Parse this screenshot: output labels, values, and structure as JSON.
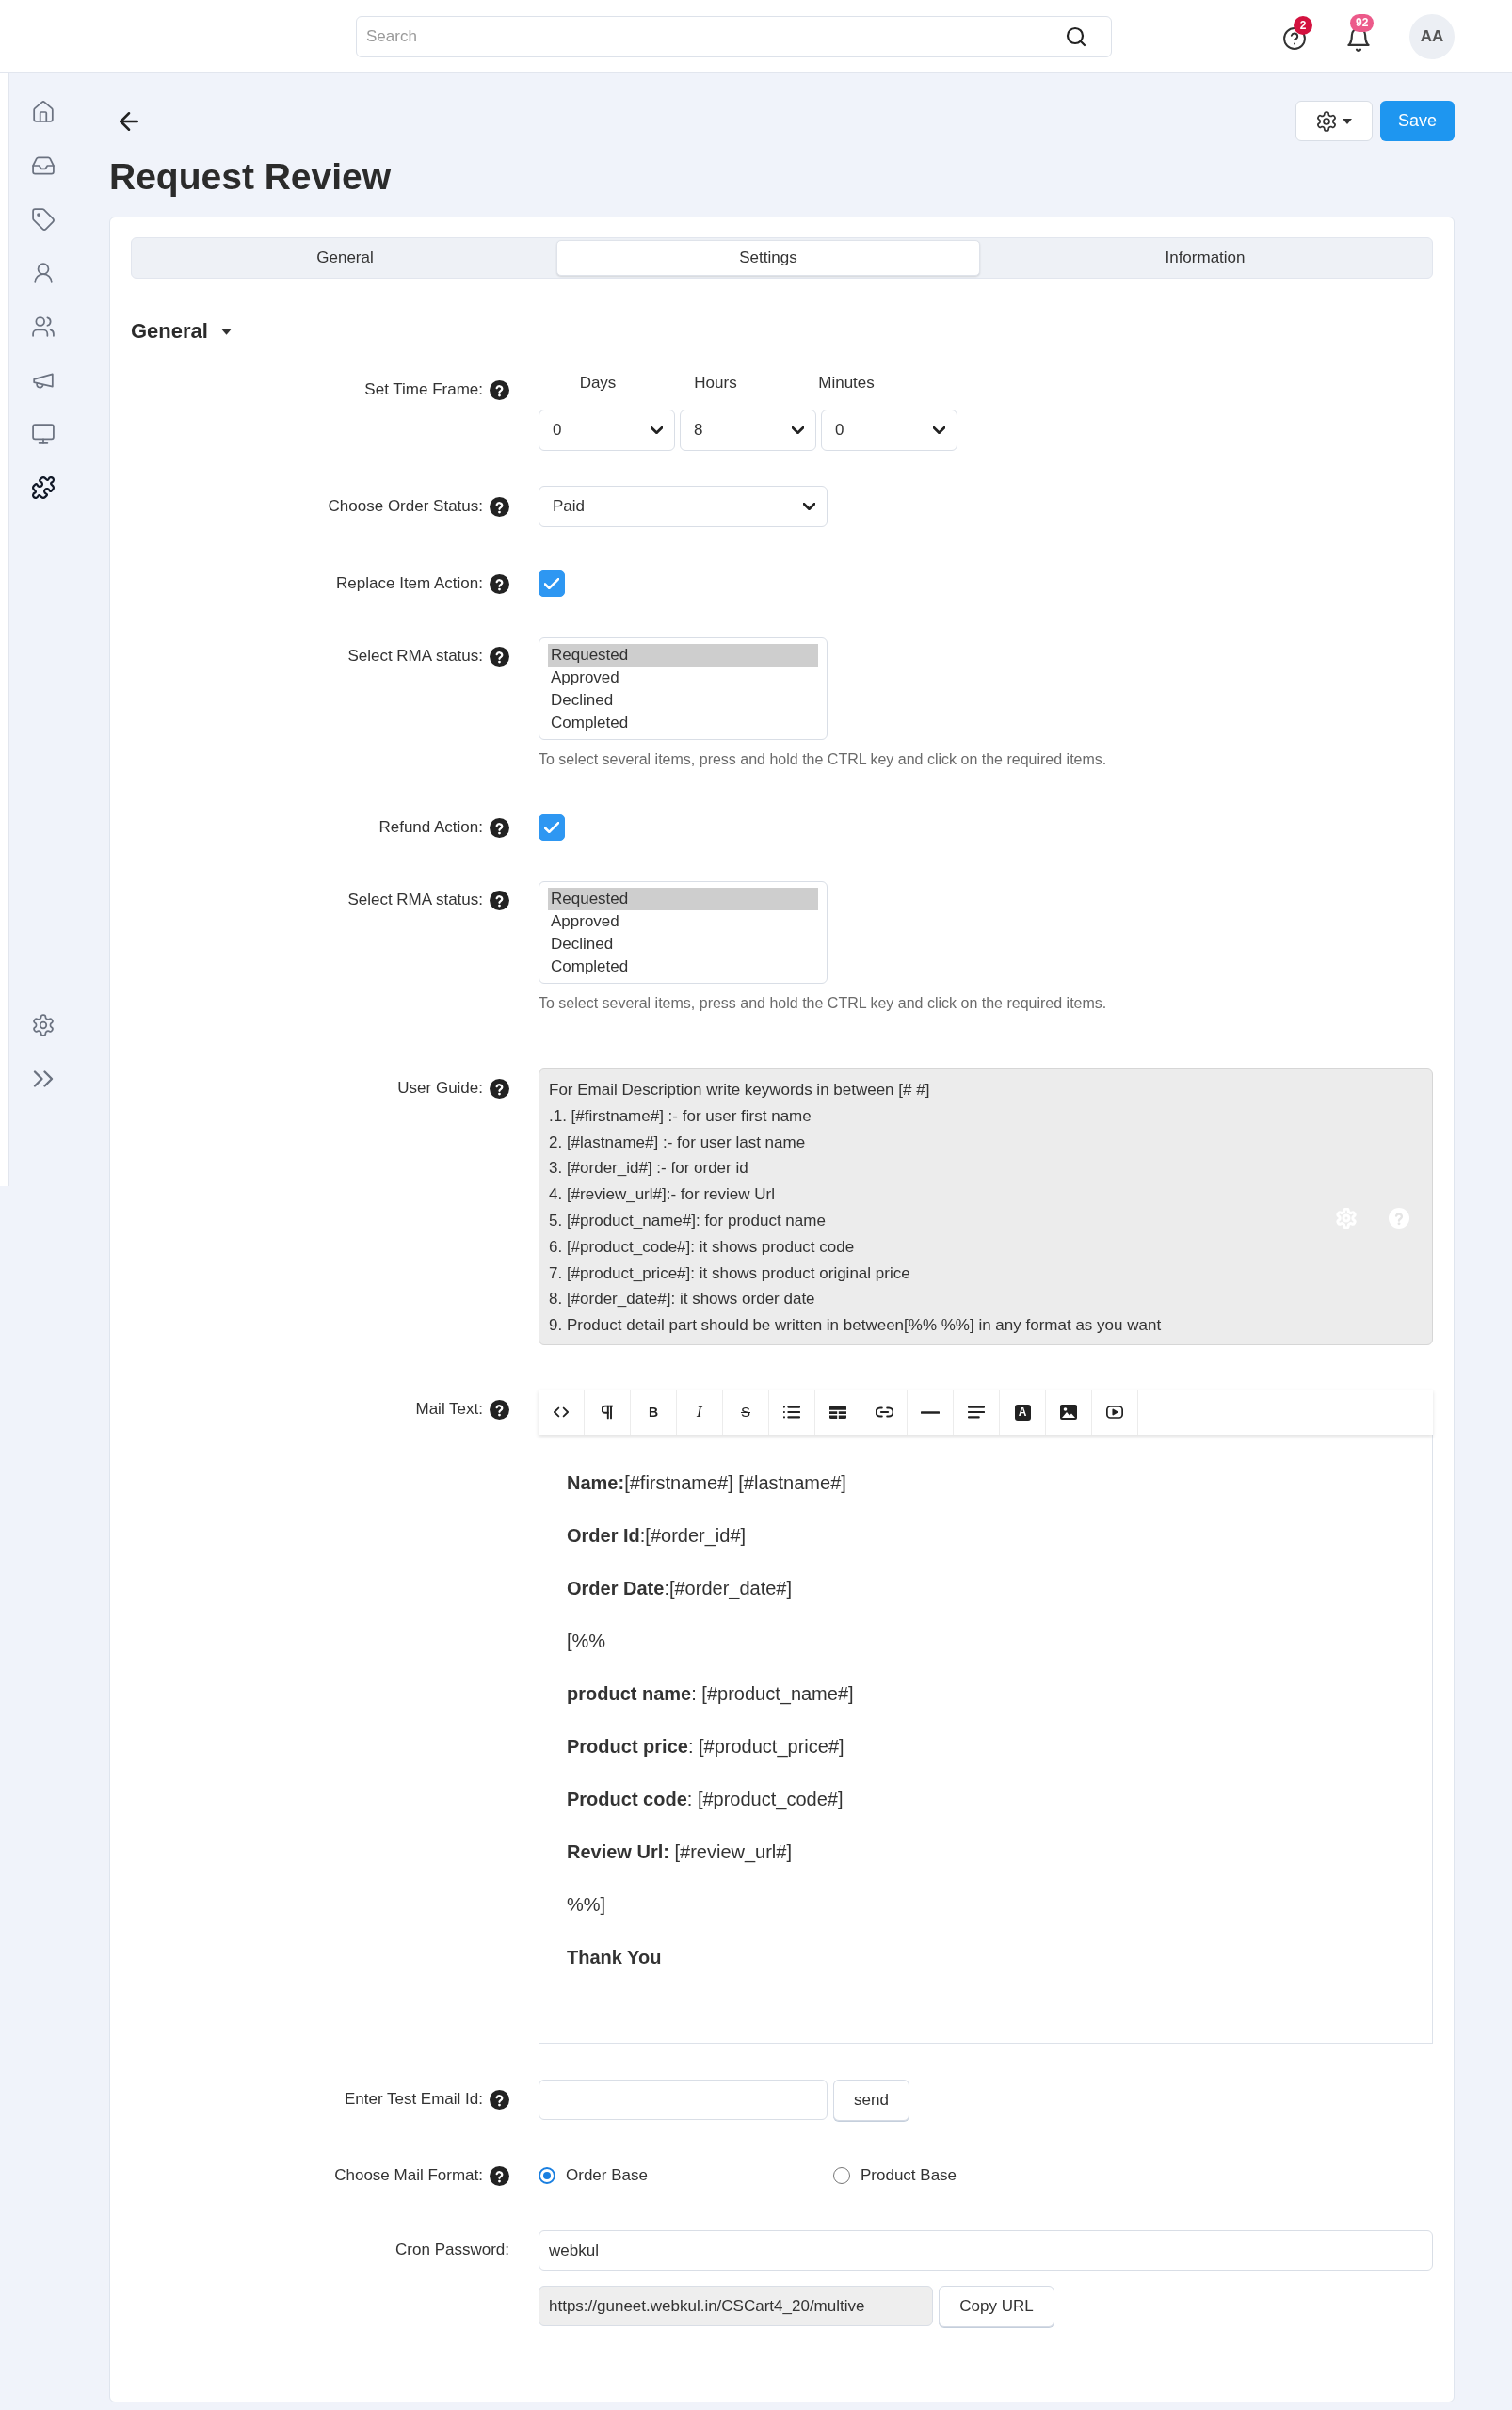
{
  "top_bar": {
    "search": {
      "placeholder": "Search"
    },
    "help": {
      "badge": "2"
    },
    "notifications": {
      "badge": "92"
    },
    "avatar": "AA"
  },
  "sidebar": {
    "expanded": false,
    "items": [
      {
        "kind": "home",
        "selected": false
      },
      {
        "kind": "inbox",
        "selected": false
      },
      {
        "kind": "tag",
        "selected": false
      },
      {
        "kind": "user",
        "selected": false
      },
      {
        "kind": "users",
        "selected": false
      },
      {
        "kind": "megaphone",
        "selected": false
      },
      {
        "kind": "monitor",
        "selected": false
      },
      {
        "kind": "puzzle",
        "selected": true
      }
    ],
    "footer_items": [
      {
        "kind": "gear",
        "selected": false
      }
    ]
  },
  "page": {
    "title": "Request Review",
    "save_button": "Save"
  },
  "tabs": [
    {
      "label": "General",
      "selected": false
    },
    {
      "label": "Settings",
      "selected": true
    },
    {
      "label": "Information",
      "selected": false
    }
  ],
  "section": {
    "title": "General",
    "expanded": true
  },
  "fields": [
    {
      "kind": "time_frame",
      "label": "Set Time Frame:",
      "help": true,
      "columns": [
        {
          "label": "Days",
          "value": "0"
        },
        {
          "label": "Hours",
          "value": "8"
        },
        {
          "label": "Minutes",
          "value": "0"
        }
      ]
    },
    {
      "kind": "select",
      "label": "Choose Order Status:",
      "help": true,
      "value": "Paid"
    },
    {
      "kind": "checkbox",
      "label": "Replace Item Action:",
      "help": true,
      "checked": true
    },
    {
      "kind": "listbox",
      "label": "Select RMA status:",
      "help": true,
      "options": [
        {
          "label": "Requested",
          "selected": true
        },
        {
          "label": "Approved",
          "selected": false
        },
        {
          "label": "Declined",
          "selected": false
        },
        {
          "label": "Completed",
          "selected": false
        }
      ],
      "hint": "To select several items, press and hold the CTRL key and click on the required items."
    },
    {
      "kind": "checkbox",
      "label": "Refund Action:",
      "help": true,
      "checked": true
    },
    {
      "kind": "listbox",
      "label": "Select RMA status:",
      "help": true,
      "options": [
        {
          "label": "Requested",
          "selected": true
        },
        {
          "label": "Approved",
          "selected": false
        },
        {
          "label": "Declined",
          "selected": false
        },
        {
          "label": "Completed",
          "selected": false
        }
      ],
      "hint": "To select several items, press and hold the CTRL key and click on the required items."
    },
    {
      "kind": "textarea",
      "label": "User Guide:",
      "help": true,
      "lines": [
        "For Email Description write keywords in between [# #]",
        ".1. [#firstname#] :- for user first name",
        "2. [#lastname#] :- for user last name",
        "3. [#order_id#] :- for order id",
        "4. [#review_url#]:- for review Url",
        "5. [#product_name#]: for product name",
        "6. [#product_code#]: it shows product code",
        "7. [#product_price#]: it shows product original price",
        "8. [#order_date#]: it shows order date",
        "9. Product detail part should be written in between[%% %%] in any format as you want"
      ]
    },
    {
      "kind": "editor",
      "label": "Mail Text:",
      "help": true,
      "toolbar": [
        {
          "kind": "code"
        },
        {
          "kind": "paragraph"
        },
        {
          "kind": "bold",
          "label": "B"
        },
        {
          "kind": "italic",
          "label": "I"
        },
        {
          "kind": "strikethrough",
          "label": "S"
        },
        {
          "kind": "list"
        },
        {
          "kind": "table"
        },
        {
          "kind": "link"
        },
        {
          "kind": "rule"
        },
        {
          "kind": "align"
        },
        {
          "kind": "color",
          "label": "A"
        },
        {
          "kind": "image"
        },
        {
          "kind": "video"
        }
      ],
      "paragraphs": [
        {
          "text": "**Name:**[#firstname#] [#lastname#]",
          "bold": false
        },
        {
          "text": "**Order Id**:[#order_id#]",
          "bold": false
        },
        {
          "text": "**Order Date**:[#order_date#]",
          "bold": false
        },
        {
          "text": "[%%",
          "bold": false
        },
        {
          "text": "**product name**: [#product_name#]",
          "bold": false
        },
        {
          "text": "**Product price**: [#product_price#]",
          "bold": false
        },
        {
          "text": "**Product code**: [#product_code#]",
          "bold": false
        },
        {
          "text": "**Review Url:** [#review_url#]",
          "bold": false
        },
        {
          "text": "%%]",
          "bold": false
        },
        {
          "text": "Thank You",
          "bold": true
        }
      ]
    },
    {
      "kind": "email_test",
      "label": "Enter Test Email Id:",
      "help": true,
      "button": "send"
    },
    {
      "kind": "radio",
      "label": "Choose Mail Format:",
      "help": true,
      "options": [
        {
          "label": "Order Base",
          "selected": true
        },
        {
          "label": "Product Base",
          "selected": false
        }
      ]
    },
    {
      "kind": "cron",
      "label": "Cron Password:",
      "help": false,
      "value": "webkul",
      "url": "https://guneet.webkul.in/CSCart4_20/multive",
      "button": "Copy URL"
    }
  ]
}
